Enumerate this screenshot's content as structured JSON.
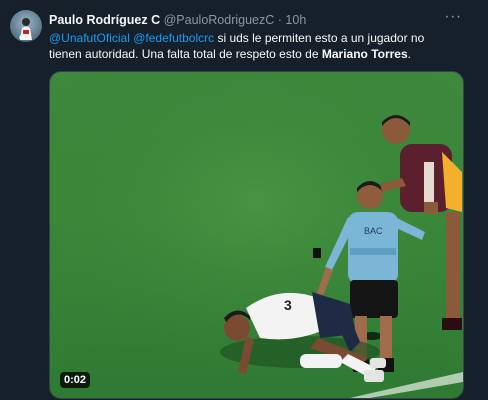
{
  "tweet": {
    "author_name": "Paulo Rodríguez C",
    "author_handle": "@PauloRodriguezC",
    "separator": "·",
    "time": "10h",
    "more_label": "···",
    "text": {
      "mention1": "@UnafutOficial",
      "mention2": "@fedefutbolcrc",
      "body": " si uds le permiten esto a un jugador no tienen autoridad. Una falta total de respeto esto de ",
      "bold_name": "Mariano Torres",
      "end": "."
    },
    "video": {
      "duration": "0:02"
    }
  },
  "colors": {
    "background": "#15202b",
    "link": "#1d9bf0",
    "muted": "#8b98a5",
    "pitch": "#3c8a3b"
  }
}
